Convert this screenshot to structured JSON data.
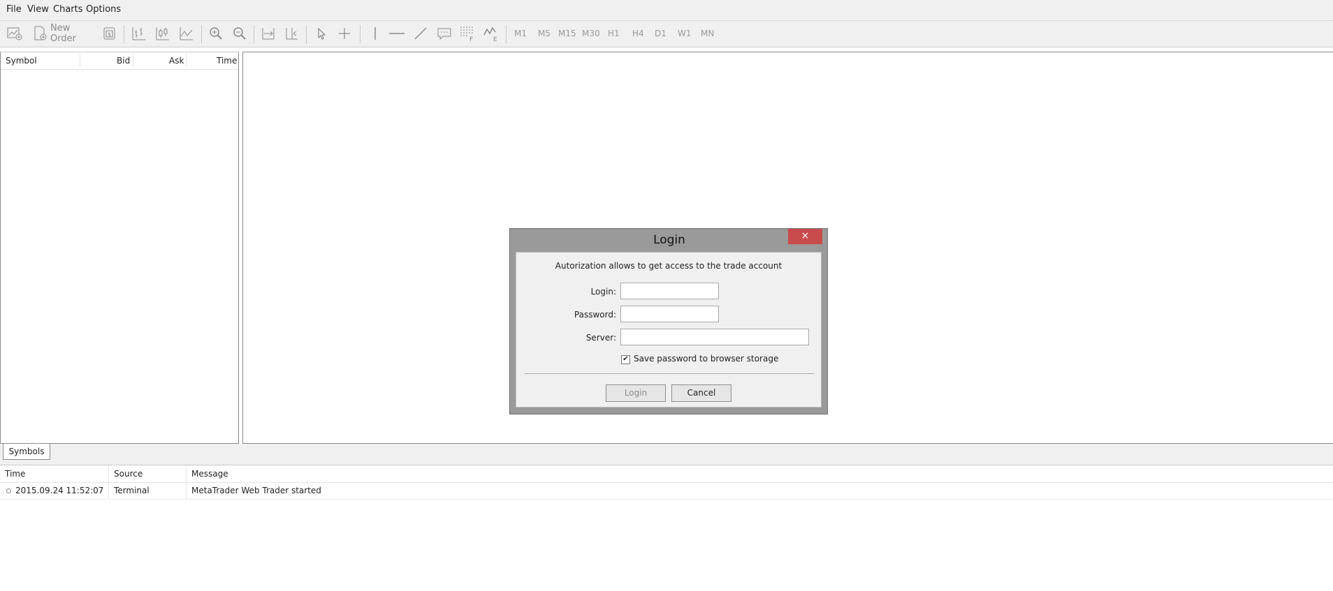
{
  "menu": [
    "File",
    "View",
    "Charts",
    "Options"
  ],
  "toolbar": {
    "new_order_label": "New Order",
    "timeframes": [
      "M1",
      "M5",
      "M15",
      "M30",
      "H1",
      "H4",
      "D1",
      "W1",
      "MN"
    ]
  },
  "market_watch": {
    "columns": [
      "Symbol",
      "Bid",
      "Ask",
      "Time"
    ]
  },
  "tabs": [
    "Symbols"
  ],
  "journal": {
    "columns": [
      "Time",
      "Source",
      "Message"
    ],
    "rows": [
      {
        "time": "2015.09.24 11:52:07",
        "source": "Terminal",
        "message": "MetaTrader Web Trader started"
      }
    ]
  },
  "login_dialog": {
    "title": "Login",
    "close_glyph": "×",
    "info": "Autorization allows to get access to the trade account",
    "login_label": "Login:",
    "password_label": "Password:",
    "server_label": "Server:",
    "login_value": "",
    "password_value": "",
    "server_value": "",
    "save_password_label": "Save password to browser storage",
    "save_password_checked": true,
    "login_button": "Login",
    "cancel_button": "Cancel"
  },
  "colors": {
    "close_button": "#c94c4c",
    "chrome": "#f0f0f0"
  }
}
